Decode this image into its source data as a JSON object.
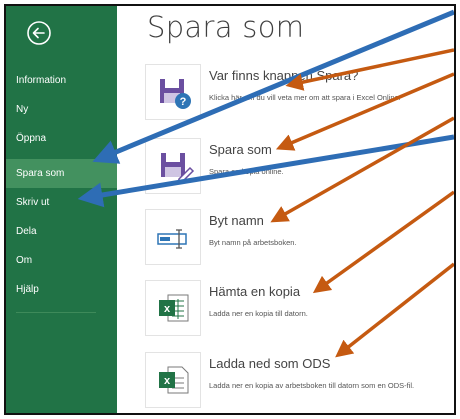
{
  "page_title": "Spara som",
  "sidebar": {
    "items": [
      {
        "label": "Information"
      },
      {
        "label": "Ny"
      },
      {
        "label": "Öppna"
      },
      {
        "label": "Spara som"
      },
      {
        "label": "Skriv ut"
      },
      {
        "label": "Dela"
      },
      {
        "label": "Om"
      },
      {
        "label": "Hjälp"
      }
    ],
    "active_item": "Spara som"
  },
  "options": [
    {
      "title": "Var finns knappen Spara?",
      "description": "Klicka här om du vill veta mer om att spara i Excel Online.",
      "icon": "save-help-icon"
    },
    {
      "title": "Spara som",
      "description": "Spara en kopia online.",
      "icon": "save-as-icon"
    },
    {
      "title": "Byt namn",
      "description": "Byt namn på arbetsboken.",
      "icon": "rename-icon"
    },
    {
      "title": "Hämta en kopia",
      "description": "Ladda ner en kopia till datorn.",
      "icon": "excel-file-icon"
    },
    {
      "title": "Ladda ned som ODS",
      "description": "Ladda ner en kopia av arbetsboken till datorn som en ODS-fil.",
      "icon": "excel-ods-icon"
    }
  ],
  "colors": {
    "sidebar": "#217346",
    "sidebar_active": "#43915f",
    "blue_arrow": "#2e6db5",
    "orange_arrow": "#c55a11"
  }
}
